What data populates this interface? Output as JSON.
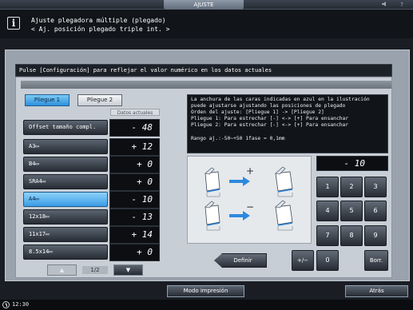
{
  "topbar": {
    "tab_label": "AJUSTE",
    "icons": [
      "speaker-icon",
      "help-icon"
    ],
    "help_glyph": "?"
  },
  "header": {
    "icon_glyph": "i",
    "line1": "Ajuste plegadora múltiple (plegado)",
    "line2": "< Aj. posición plegado triple int. >"
  },
  "message": "Pulse [Configuración] para reflejar el valor numérico en los datos actuales",
  "tabs": [
    {
      "label": "Pliegue 1",
      "selected": true
    },
    {
      "label": "Pliegue 2",
      "selected": false
    }
  ],
  "column_header": "Datos actuales",
  "rows": [
    {
      "label": "Offset tamaño compl.",
      "value": "- 48",
      "selected": false
    },
    {
      "label": "A3▭",
      "value": "+ 12",
      "selected": false
    },
    {
      "label": "B4▭",
      "value": "+ 0",
      "selected": false
    },
    {
      "label": "SRA4▭",
      "value": "+ 0",
      "selected": false
    },
    {
      "label": "A4▭",
      "value": "- 10",
      "selected": true
    },
    {
      "label": "12x18▭",
      "value": "- 13",
      "selected": false
    },
    {
      "label": "11x17▭",
      "value": "+ 14",
      "selected": false
    },
    {
      "label": "8.5x14▭",
      "value": "+ 0",
      "selected": false
    }
  ],
  "pagination": {
    "up_glyph": "▲",
    "down_glyph": "▼",
    "indicator": "1/2"
  },
  "info": {
    "lines": [
      "La anchura de las caras indicadas en azul en la ilustración",
      "puede ajustarse ajustando las posiciones de plegado",
      "Orden del ajuste: [Pliegue 1] -> [Pliegue 2]",
      "Pliegue 1: Para estrechar [-]  <->  [+] Para ensanchar",
      "Pliegue 2: Para estrechar [-]  <->  [+] Para ensanchar"
    ],
    "range": "Rango aj.:-50~+50 1fase = 0,1mm"
  },
  "illustration": {
    "plus_sign": "+",
    "minus_sign": "−"
  },
  "keypad": {
    "display": "- 10",
    "keys": [
      "1",
      "2",
      "3",
      "4",
      "5",
      "6",
      "7",
      "8",
      "9"
    ],
    "zero": "0",
    "plus_minus": "+/−",
    "clear": "Borr."
  },
  "definir_label": "Definir",
  "bottom": {
    "modo_impresion": "Modo impresión",
    "atras": "Atrás",
    "clock": "12:30"
  }
}
